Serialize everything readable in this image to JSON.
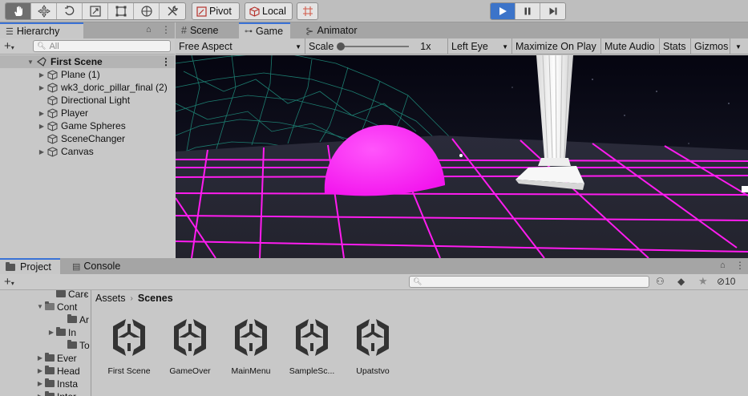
{
  "toolbar": {
    "pivot_label": "Pivot",
    "local_label": "Local"
  },
  "hierarchy": {
    "tab_label": "Hierarchy",
    "search_placeholder": "All",
    "scene_name": "First Scene",
    "items": [
      {
        "label": "Plane (1)",
        "expandable": true
      },
      {
        "label": "wk3_doric_pillar_final (2)",
        "expandable": true
      },
      {
        "label": "Directional Light",
        "expandable": false
      },
      {
        "label": "Player",
        "expandable": true
      },
      {
        "label": "Game Spheres",
        "expandable": true
      },
      {
        "label": "SceneChanger",
        "expandable": false
      },
      {
        "label": "Canvas",
        "expandable": true
      }
    ]
  },
  "game_tabs": {
    "scene": "Scene",
    "game": "Game",
    "animator": "Animator"
  },
  "game_bar": {
    "aspect": "Free Aspect",
    "scale_label": "Scale",
    "scale_value": "1x",
    "eye": "Left Eye",
    "maximize": "Maximize On Play",
    "mute": "Mute Audio",
    "stats": "Stats",
    "gizmos": "Gizmos"
  },
  "project": {
    "tab_label": "Project",
    "console_label": "Console",
    "hidden_count": "10",
    "tree": [
      {
        "label": "Carc",
        "indent": 1,
        "arrow": ""
      },
      {
        "label": "Cont",
        "indent": 0,
        "arrow": "▼"
      },
      {
        "label": "Ar",
        "indent": 2,
        "arrow": ""
      },
      {
        "label": "In",
        "indent": 1,
        "arrow": "▶"
      },
      {
        "label": "To",
        "indent": 2,
        "arrow": ""
      },
      {
        "label": "Ever",
        "indent": 0,
        "arrow": "▶"
      },
      {
        "label": "Head",
        "indent": 0,
        "arrow": "▶"
      },
      {
        "label": "Insta",
        "indent": 0,
        "arrow": "▶"
      },
      {
        "label": "Inter",
        "indent": 0,
        "arrow": "▶"
      }
    ],
    "breadcrumb": [
      "Assets",
      "Scenes"
    ],
    "assets": [
      "First Scene",
      "GameOver",
      "MainMenu",
      "SampleSc...",
      "Upatstvo"
    ]
  },
  "colors": {
    "accent": "#3c74c9",
    "grid": "#ff1cf0",
    "sphere": "#ff2bf5",
    "mesh": "#1f8a7a"
  }
}
